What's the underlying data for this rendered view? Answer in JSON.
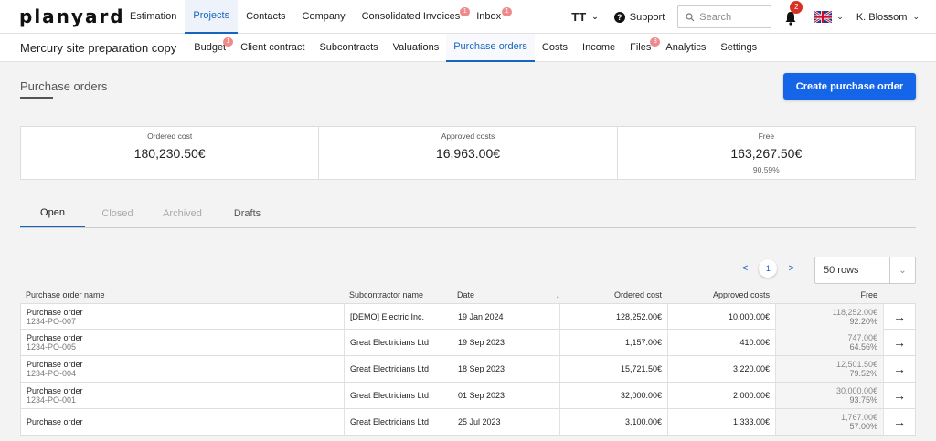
{
  "app": {
    "logo": "planyard"
  },
  "mainnav": [
    {
      "label": "Estimation",
      "badge": ""
    },
    {
      "label": "Projects",
      "badge": ""
    },
    {
      "label": "Contacts",
      "badge": ""
    },
    {
      "label": "Company",
      "badge": ""
    },
    {
      "label": "Consolidated Invoices",
      "badge": "1"
    },
    {
      "label": "Inbox",
      "badge": "1"
    }
  ],
  "topright": {
    "text_size": "TT",
    "support": "Support",
    "search_placeholder": "Search",
    "notif_count": "2",
    "user": "K. Blossom"
  },
  "project": {
    "name": "Mercury site preparation copy"
  },
  "subnav": [
    {
      "label": "Budget",
      "badge": "1"
    },
    {
      "label": "Client contract",
      "badge": ""
    },
    {
      "label": "Subcontracts",
      "badge": ""
    },
    {
      "label": "Valuations",
      "badge": ""
    },
    {
      "label": "Purchase orders",
      "badge": ""
    },
    {
      "label": "Costs",
      "badge": ""
    },
    {
      "label": "Income",
      "badge": ""
    },
    {
      "label": "Files",
      "badge": "3"
    },
    {
      "label": "Analytics",
      "badge": ""
    },
    {
      "label": "Settings",
      "badge": ""
    }
  ],
  "page": {
    "title": "Purchase orders",
    "create_button": "Create purchase order"
  },
  "summary": {
    "ordered": {
      "label": "Ordered cost",
      "value": "180,230.50€"
    },
    "approved": {
      "label": "Approved costs",
      "value": "16,963.00€"
    },
    "free": {
      "label": "Free",
      "value": "163,267.50€",
      "percent": "90.59%"
    }
  },
  "tabs": [
    "Open",
    "Closed",
    "Archived",
    "Drafts"
  ],
  "pager": {
    "prev": "<",
    "page": "1",
    "next": ">",
    "rows": "50 rows"
  },
  "table": {
    "headers": {
      "name": "Purchase order name",
      "subcontractor": "Subcontractor name",
      "date": "Date",
      "ordered": "Ordered cost",
      "approved": "Approved costs",
      "free": "Free"
    },
    "rows": [
      {
        "name": "Purchase order",
        "code": "1234-PO-007",
        "subcontractor": "[DEMO] Electric Inc.",
        "date": "19 Jan 2024",
        "ordered": "128,252.00€",
        "approved": "10,000.00€",
        "free": "118,252.00€",
        "free_pct": "92.20%"
      },
      {
        "name": "Purchase order",
        "code": "1234-PO-005",
        "subcontractor": "Great Electricians Ltd",
        "date": "19 Sep 2023",
        "ordered": "1,157.00€",
        "approved": "410.00€",
        "free": "747.00€",
        "free_pct": "64.56%"
      },
      {
        "name": "Purchase order",
        "code": "1234-PO-004",
        "subcontractor": "Great Electricians Ltd",
        "date": "18 Sep 2023",
        "ordered": "15,721.50€",
        "approved": "3,220.00€",
        "free": "12,501.50€",
        "free_pct": "79.52%"
      },
      {
        "name": "Purchase order",
        "code": "1234-PO-001",
        "subcontractor": "Great Electricians Ltd",
        "date": "01 Sep 2023",
        "ordered": "32,000.00€",
        "approved": "2,000.00€",
        "free": "30,000.00€",
        "free_pct": "93.75%"
      },
      {
        "name": "Purchase order",
        "code": "",
        "subcontractor": "Great Electricians Ltd",
        "date": "25 Jul 2023",
        "ordered": "3,100.00€",
        "approved": "1,333.00€",
        "free": "1,767.00€",
        "free_pct": "57.00%"
      }
    ]
  }
}
